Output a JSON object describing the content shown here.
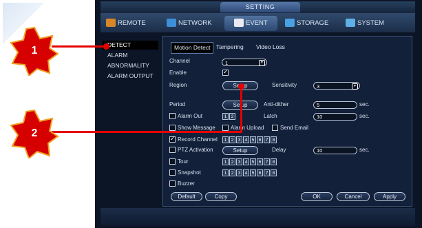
{
  "window": {
    "title": "SETTING"
  },
  "main_tabs": [
    {
      "label": "REMOTE",
      "icon": "remote-icon"
    },
    {
      "label": "NETWORK",
      "icon": "network-icon"
    },
    {
      "label": "EVENT",
      "icon": "event-icon",
      "active": true
    },
    {
      "label": "STORAGE",
      "icon": "storage-icon"
    },
    {
      "label": "SYSTEM",
      "icon": "system-icon"
    }
  ],
  "sidebar": {
    "items": [
      {
        "label": "DETECT",
        "active": true
      },
      {
        "label": "ALARM"
      },
      {
        "label": "ABNORMALITY"
      },
      {
        "label": "ALARM OUTPUT"
      }
    ]
  },
  "subtabs": [
    "Motion Detect",
    "Tampering",
    "Video Loss"
  ],
  "form": {
    "channel_label": "Channel",
    "channel_value": "1",
    "enable_label": "Enable",
    "enable_checked": true,
    "region_label": "Region",
    "region_button": "Setup",
    "sensitivity_label": "Sensitivity",
    "sensitivity_value": "3",
    "period_label": "Period",
    "period_button": "Setup",
    "antidither_label": "Anti-dither",
    "antidither_value": "5",
    "antidither_unit": "sec.",
    "alarm_out_label": "Alarm Out",
    "alarm_out_channels": [
      "1",
      "2"
    ],
    "latch_label": "Latch",
    "latch_value": "10",
    "latch_unit": "sec.",
    "show_message_label": "Show Message",
    "alarm_upload_label": "Alarm Upload",
    "send_email_label": "Send Email",
    "record_channel_label": "Record Channel",
    "record_channel_checked": true,
    "channels": [
      "1",
      "2",
      "3",
      "4",
      "5",
      "6",
      "7",
      "8"
    ],
    "ptz_label": "PTZ Activation",
    "ptz_button": "Setup",
    "delay_label": "Delay",
    "delay_value": "10",
    "delay_unit": "sec.",
    "tour_label": "Tour",
    "snapshot_label": "Snapshot",
    "buzzer_label": "Buzzer"
  },
  "buttons": {
    "default": "Default",
    "copy": "Copy",
    "ok": "OK",
    "cancel": "Cancel",
    "apply": "Apply"
  },
  "callouts": [
    {
      "number": "1"
    },
    {
      "number": "2"
    }
  ],
  "colors": {
    "callout": "#e60000",
    "panel_bg": "#12203a"
  }
}
